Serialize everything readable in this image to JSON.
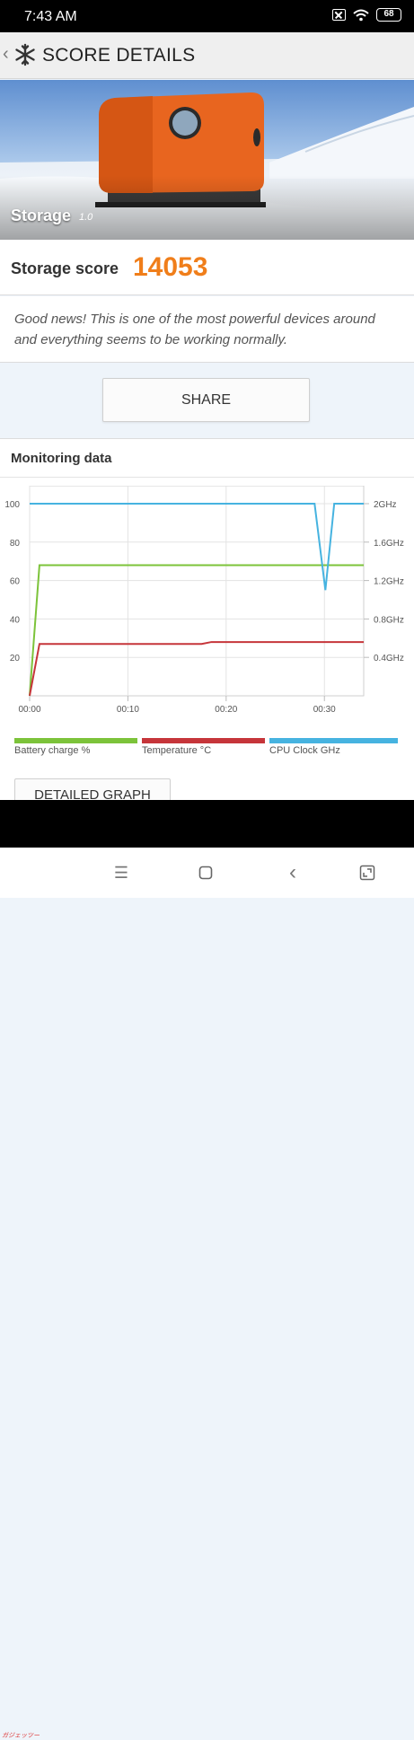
{
  "status_bar": {
    "time": "7:43 AM",
    "battery": "68"
  },
  "header": {
    "title": "SCORE DETAILS"
  },
  "hero": {
    "label": "Storage",
    "version": "1.0"
  },
  "score": {
    "label": "Storage score",
    "value": "14053"
  },
  "message": {
    "text": "Good news! This is one of the most powerful devices around and everything seems to be working normally."
  },
  "share": {
    "label": "SHARE"
  },
  "monitoring": {
    "title": "Monitoring data",
    "detailed_label": "DETAILED GRAPH"
  },
  "colors": {
    "accent": "#f07e1a",
    "battery": "#7cc33a",
    "temperature": "#c6353a",
    "cpu": "#46b3e0"
  },
  "chart_data": {
    "type": "line",
    "x_ticks": [
      "00:00",
      "00:10",
      "00:20",
      "00:30"
    ],
    "x_range_min": [
      0,
      34
    ],
    "left_axis_ticks": [
      "100",
      "80",
      "60",
      "40",
      "20"
    ],
    "right_axis_ticks": [
      "2GHz",
      "1.6GHz",
      "1.2GHz",
      "0.8GHz",
      "0.4GHz"
    ],
    "ylim": [
      0,
      100
    ],
    "series": [
      {
        "name": "Battery charge %",
        "color": "#7cc33a",
        "x": [
          0,
          1,
          34
        ],
        "y": [
          0,
          68,
          68
        ]
      },
      {
        "name": "Temperature °C",
        "color": "#c6353a",
        "x": [
          0,
          1,
          17.5,
          18.5,
          34
        ],
        "y": [
          0,
          27,
          27,
          28,
          28
        ]
      },
      {
        "name": "CPU Clock GHz",
        "color": "#46b3e0",
        "x": [
          0,
          29,
          30.1,
          31,
          34
        ],
        "y": [
          2.0,
          2.0,
          1.1,
          2.0,
          2.0
        ]
      }
    ],
    "legend_placement": "bottom",
    "grid": true
  },
  "nav": {
    "menu_icon": "☰",
    "home_icon": "□",
    "back_icon": "‹",
    "recents_icon": "⤢"
  },
  "watermark": {
    "text": "ガジェッツー"
  }
}
